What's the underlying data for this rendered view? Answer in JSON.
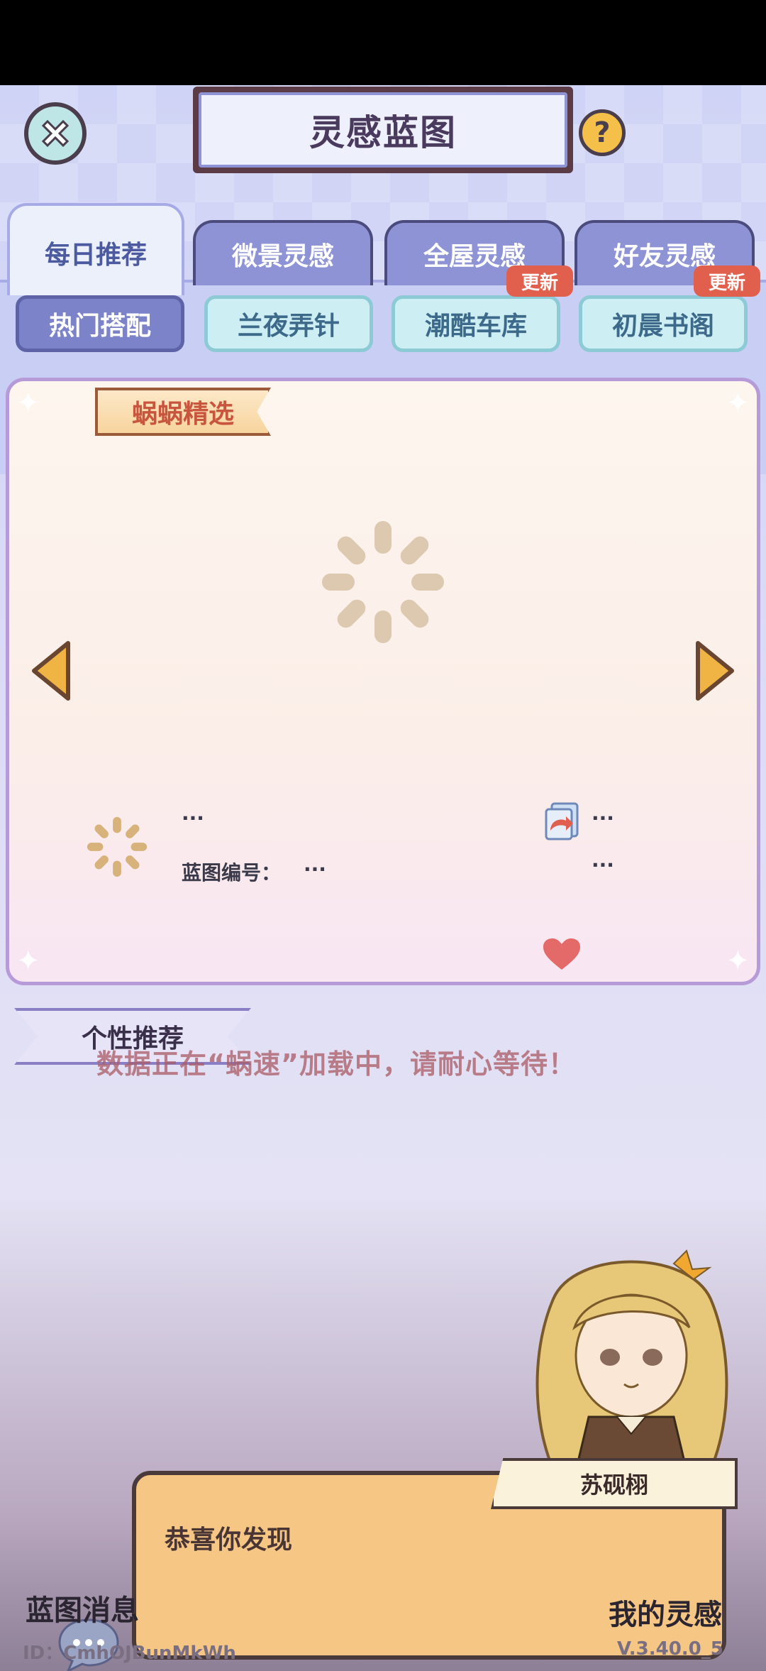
{
  "header": {
    "title": "灵感蓝图"
  },
  "tabs": [
    {
      "label": "每日推荐",
      "active": true
    },
    {
      "label": "微景灵感",
      "active": false
    },
    {
      "label": "全屋灵感",
      "active": false
    },
    {
      "label": "好友灵感",
      "active": false
    }
  ],
  "chips": [
    {
      "label": "热门搭配",
      "active": true,
      "badge": ""
    },
    {
      "label": "兰夜弄针",
      "active": false,
      "badge": ""
    },
    {
      "label": "潮酷车库",
      "active": false,
      "badge": "更新"
    },
    {
      "label": "初晨书阁",
      "active": false,
      "badge": "更新"
    }
  ],
  "featured": {
    "ribbon": "蜗蜗精选",
    "author": "···",
    "blueprint_id_label": "蓝图编号：",
    "blueprint_id_value": "···",
    "share_count": "···",
    "like_count": "···"
  },
  "personal": {
    "title": "个性推荐",
    "loading_message": "数据正在“蜗速”加载中，请耐心等待！"
  },
  "dialog": {
    "speaker": "苏砚栩",
    "text": "恭喜你发现"
  },
  "bottom": {
    "messages_label": "蓝图消息",
    "my_inspiration_label": "我的灵感",
    "user_id": "ID：CmhOJBunMkWh",
    "version": "V.3.40.0_5"
  },
  "colors": {
    "accent": "#8e93d6",
    "badge": "#e0604d",
    "dialog_bg": "#f5c684"
  }
}
